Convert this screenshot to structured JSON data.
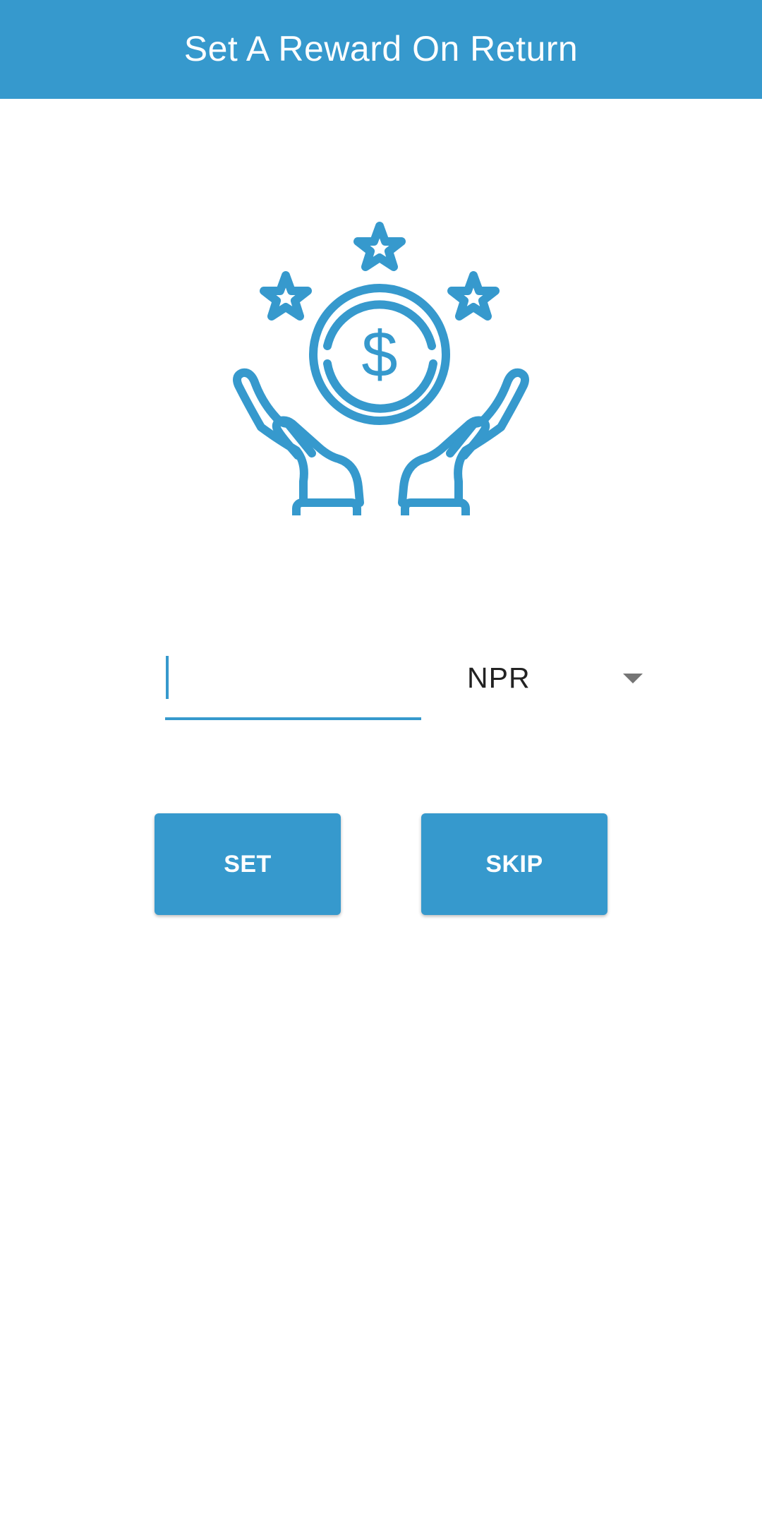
{
  "header": {
    "title": "Set A Reward On Return"
  },
  "hero": {
    "icon": "reward-coin-hands-icon"
  },
  "form": {
    "amount": {
      "value": "",
      "placeholder": ""
    },
    "currency": {
      "selected": "NPR"
    }
  },
  "actions": {
    "set_label": "SET",
    "skip_label": "SKIP"
  },
  "colors": {
    "primary": "#3699CD",
    "text": "#222222",
    "arrow": "#757575"
  }
}
